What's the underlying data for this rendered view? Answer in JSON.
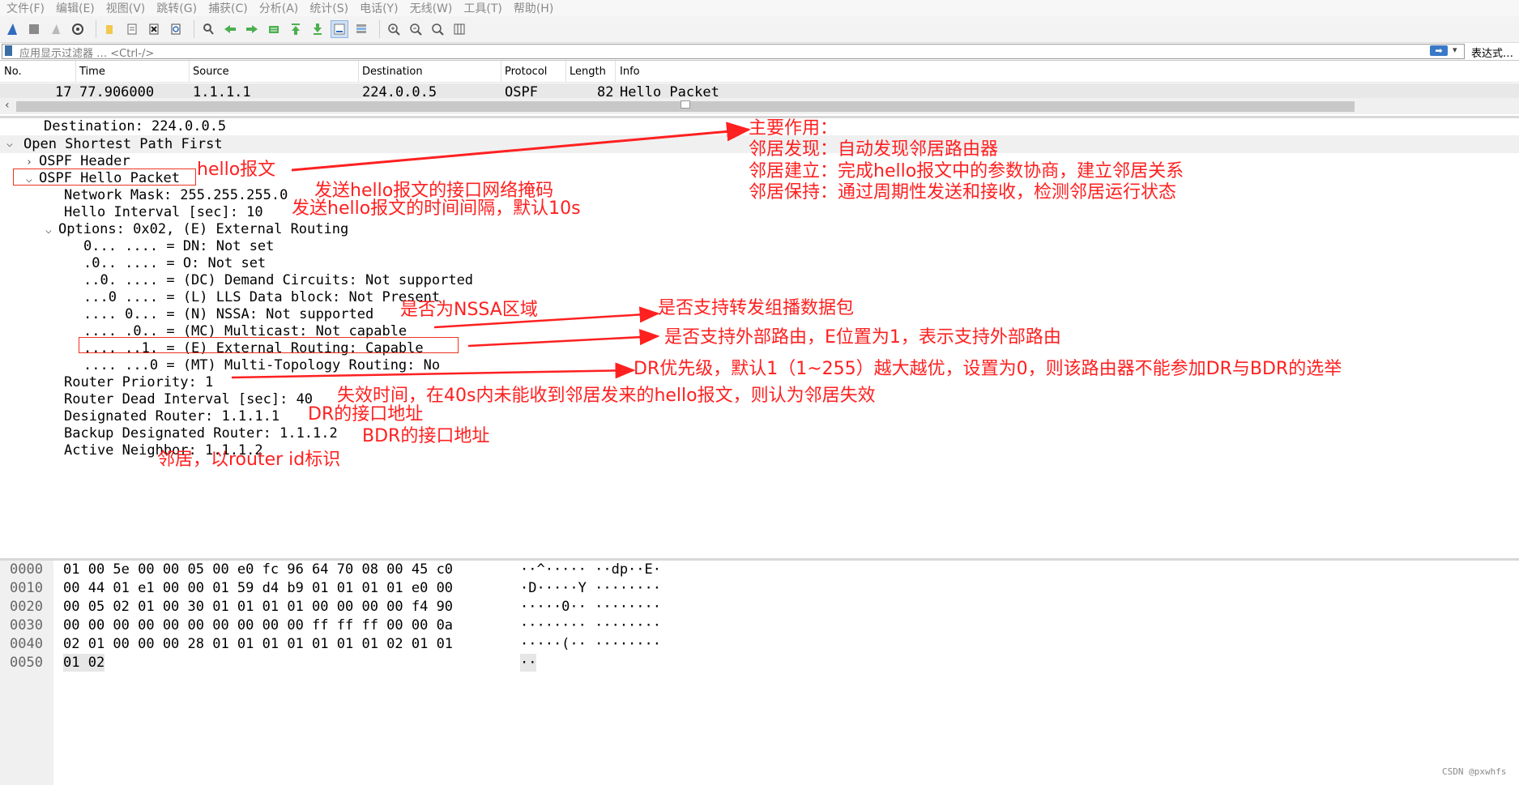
{
  "menu": [
    "文件(F)",
    "编辑(E)",
    "视图(V)",
    "跳转(G)",
    "捕获(C)",
    "分析(A)",
    "统计(S)",
    "电话(Y)",
    "无线(W)",
    "工具(T)",
    "帮助(H)"
  ],
  "toolbar": {
    "icons": [
      "shark-fin-icon",
      "stop-icon",
      "restart-icon",
      "options-gear-icon",
      "open-folder-icon",
      "save-file-icon",
      "close-file-icon",
      "reload-icon",
      "find-icon",
      "back-arrow-icon",
      "forward-arrow-icon",
      "go-to-packet-icon",
      "first-packet-icon",
      "last-packet-icon",
      "autoscroll-icon",
      "colorize-icon",
      "zoom-in-icon",
      "zoom-out-icon",
      "normal-size-icon",
      "resize-columns-icon"
    ]
  },
  "filter": {
    "placeholder": "应用显示过滤器 … <Ctrl-/>",
    "expression_label": "表达式…"
  },
  "packet_list": {
    "columns": [
      "No.",
      "Time",
      "Source",
      "Destination",
      "Protocol",
      "Length",
      "Info"
    ],
    "row": {
      "no": "17",
      "time": "77.906000",
      "source": "1.1.1.1",
      "destination": "224.0.0.5",
      "protocol": "OSPF",
      "length": "82",
      "info": "Hello Packet"
    }
  },
  "details": {
    "rows": [
      "Destination: 224.0.0.5",
      "Open Shortest Path First",
      "OSPF Header",
      "OSPF Hello Packet",
      "Network Mask: 255.255.255.0",
      "Hello Interval [sec]: 10",
      "Options: 0x02, (E) External Routing",
      "0... .... = DN: Not set",
      ".0.. .... = O: Not set",
      "..0. .... = (DC) Demand Circuits: Not supported",
      "...0 .... = (L) LLS Data block: Not Present",
      ".... 0... = (N) NSSA: Not supported",
      ".... .0.. = (MC) Multicast: Not capable",
      ".... ..1. = (E) External Routing: Capable",
      ".... ...0 = (MT) Multi-Topology Routing: No",
      "Router Priority: 1",
      "Router Dead Interval [sec]: 40",
      "Designated Router: 1.1.1.1",
      "Backup Designated Router: 1.1.1.2",
      "Active Neighbor: 1.1.1.2"
    ]
  },
  "annotations": {
    "main_title": "主要作用：",
    "main_1": "邻居发现：自动发现邻居路由器",
    "main_2": "邻居建立：完成hello报文中的参数协商，建立邻居关系",
    "main_3": "邻居保持：通过周期性发送和接收，检测邻居运行状态",
    "hello": "hello报文",
    "mask": "发送hello报文的接口网络掩码",
    "interval": "发送hello报文的时间间隔，默认10s",
    "nssa": "是否为NSSA区域",
    "multicast": "是否支持转发组播数据包",
    "external": "是否支持外部路由，E位置为1，表示支持外部路由",
    "priority": "DR优先级，默认1（1~255）越大越优，设置为0，则该路由器不能参加DR与BDR的选举",
    "dead": "失效时间，在40s内未能收到邻居发来的hello报文，则认为邻居失效",
    "dr": "DR的接口地址",
    "bdr": "BDR的接口地址",
    "neighbor": "邻居，以router id标识"
  },
  "hex": {
    "rows": [
      {
        "offset": "0000",
        "bytes": "01 00 5e 00 00 05 00 e0  fc 96 64 70 08 00 45 c0",
        "ascii": "··^····· ··dp··E·"
      },
      {
        "offset": "0010",
        "bytes": "00 44 01 e1 00 00 01 59  d4 b9 01 01 01 01 e0 00",
        "ascii": "·D·····Y ········"
      },
      {
        "offset": "0020",
        "bytes": "00 05 02 01 00 30 01 01  01 01 00 00 00 00 f4 90",
        "ascii": "·····0·· ········"
      },
      {
        "offset": "0030",
        "bytes": "00 00 00 00 00 00 00 00  00 00 ff ff ff 00 00 0a",
        "ascii": "········ ········"
      },
      {
        "offset": "0040",
        "bytes": "02 01 00 00 00 28 01 01  01 01 01 01 01 02 01 01",
        "ascii": "·····(·· ········"
      },
      {
        "offset": "0050",
        "bytes": "01 02",
        "ascii": "··"
      }
    ]
  },
  "watermark": "CSDN @pxwhfs",
  "colors": {
    "annotation": "#ff2020",
    "selected_row": "#e8e8e8"
  }
}
